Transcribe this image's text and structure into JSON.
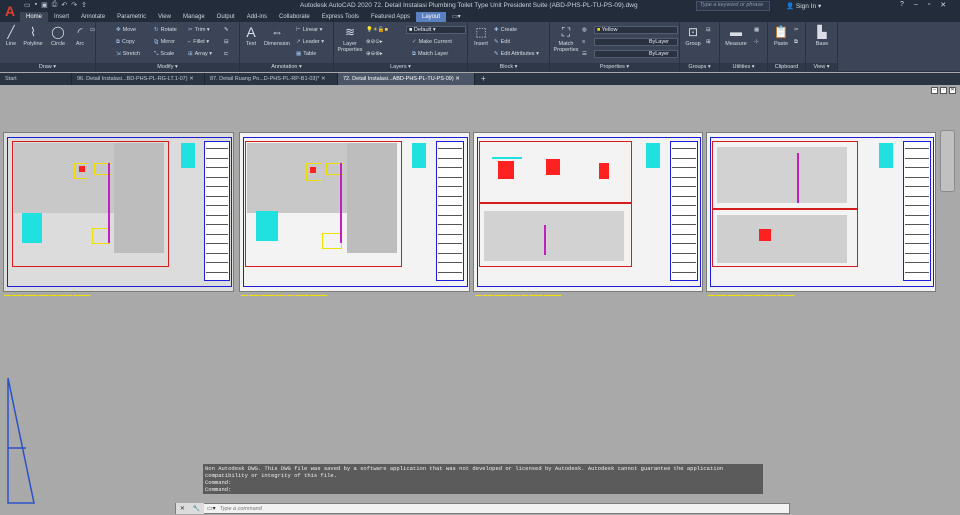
{
  "app": {
    "title": "Autodesk AutoCAD 2020   72. Detail Instalasi Plumbing Toilet Type Unit President Suite (ABD-PHS-PL-TU-PS-09).dwg",
    "search_placeholder": "Type a keyword or phrase",
    "sign_in": "Sign In",
    "logo": "A"
  },
  "qat": [
    "open-icon",
    "save-icon",
    "saveas-icon",
    "plot-icon",
    "undo-icon",
    "redo-icon",
    "share-icon"
  ],
  "tabs": [
    "Home",
    "Insert",
    "Annotate",
    "Parametric",
    "View",
    "Manage",
    "Output",
    "Add-ins",
    "Collaborate",
    "Express Tools",
    "Featured Apps",
    "Layout"
  ],
  "ribbon": {
    "draw": {
      "title": "Draw",
      "line": "Line",
      "polyline": "Polyline",
      "circle": "Circle",
      "arc": "Arc"
    },
    "modify": {
      "title": "Modify",
      "move": "Move",
      "rotate": "Rotate",
      "trim": "Trim",
      "copy": "Copy",
      "mirror": "Mirror",
      "fillet": "Fillet",
      "stretch": "Stretch",
      "scale": "Scale",
      "array": "Array"
    },
    "annotation": {
      "title": "Annotation",
      "text": "Text",
      "dimension": "Dimension",
      "linear": "Linear",
      "leader": "Leader",
      "table": "Table"
    },
    "layers": {
      "title": "Layers",
      "layer_properties": "Layer Properties",
      "layer_value": "Default",
      "make_current": "Make Current",
      "match_layer": "Match Layer"
    },
    "block": {
      "title": "Block",
      "insert": "Insert",
      "create": "Create",
      "edit": "Edit",
      "edit_attributes": "Edit Attributes"
    },
    "properties": {
      "title": "Properties",
      "match": "Match Properties",
      "color": "Yellow",
      "linetype": "ByLayer",
      "lineweight": "ByLayer"
    },
    "groups": {
      "title": "Groups",
      "group": "Group"
    },
    "utilities": {
      "title": "Utilities",
      "measure": "Measure"
    },
    "clipboard": {
      "title": "Clipboard",
      "paste": "Paste"
    },
    "view": {
      "title": "View",
      "base": "Base"
    }
  },
  "doc_tabs": [
    "Start",
    "96. Detail Instalasi...BD-PHS-PL-RG-LT.1-07)",
    "87. Detail Ruang Po...D-PHS-PL-RP-B1-03)*",
    "72. Detail Instalasi...ABD-PHS-PL-TU-PS-09)"
  ],
  "command": {
    "history": [
      "Non Autodesk DWG.  This DWG file was saved by a software application that was not developed or licensed by Autodesk.  Autodesk cannot guarantee the application",
      "compatibility or integrity of this file.",
      "Command:",
      "Command:"
    ],
    "placeholder": "Type a command"
  },
  "colors": {
    "accent": "#5a80bf",
    "ribbon": "#3b4557",
    "canvas": "#a9a9a9",
    "sheet_frame": "#1d1dd8",
    "redline": "#d61c1c",
    "cyan": "#20e0e0",
    "yellow": "#f0e000"
  }
}
